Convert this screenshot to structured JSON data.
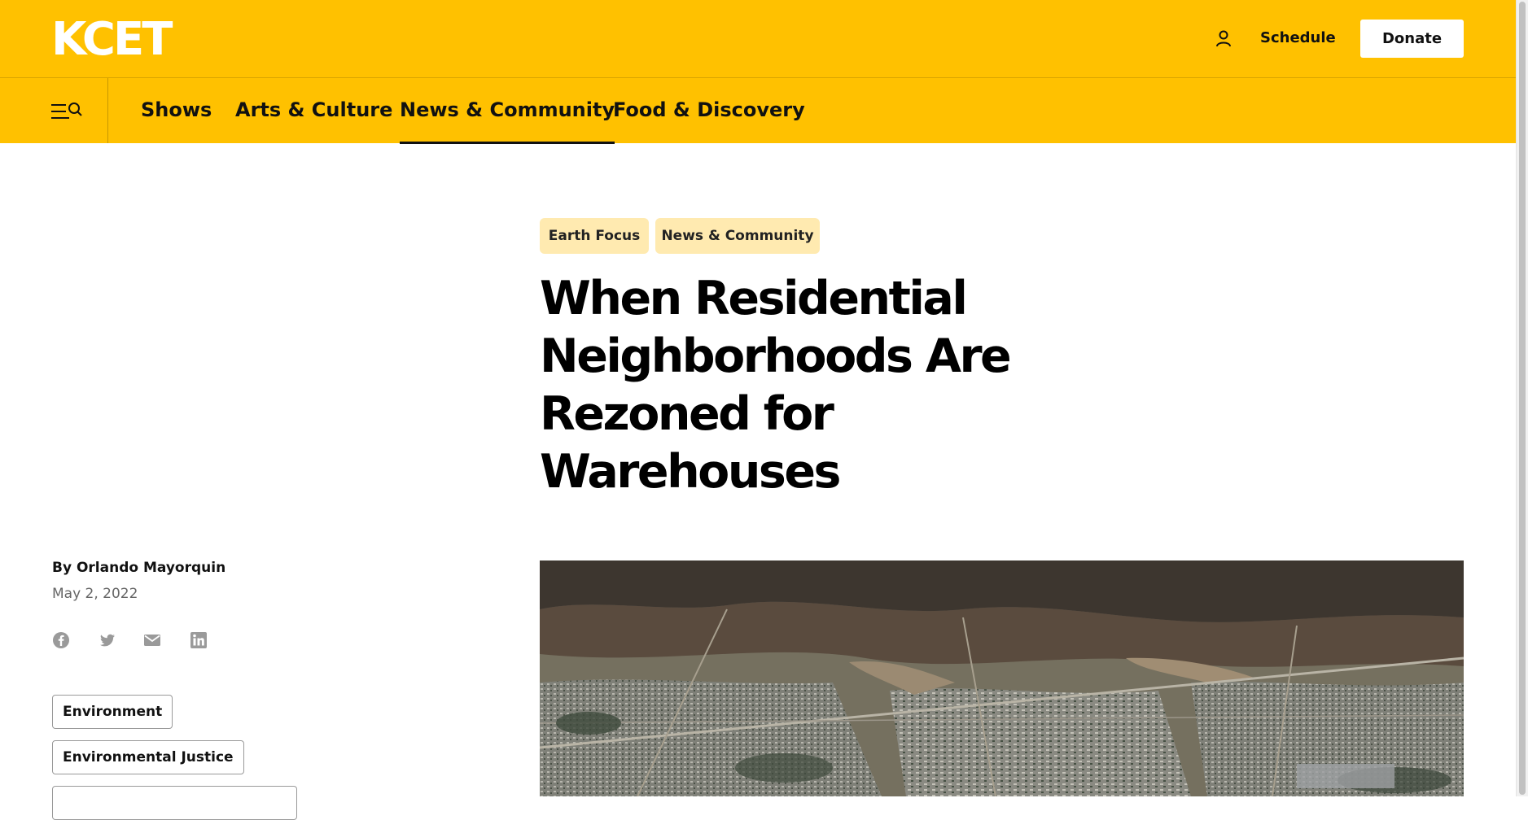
{
  "header": {
    "logo": "KCET",
    "schedule_label": "Schedule",
    "donate_label": "Donate"
  },
  "nav": {
    "items": [
      {
        "label": "Shows"
      },
      {
        "label": "Arts & Culture"
      },
      {
        "label": "News & Community",
        "active": true
      },
      {
        "label": "Food & Discovery"
      }
    ]
  },
  "article": {
    "categories": [
      "Earth Focus",
      "News & Community"
    ],
    "title_lines": [
      "When Residential",
      "Neighborhoods Are",
      "Rezoned for",
      "Warehouses"
    ],
    "byline": "By Orlando Mayorquin",
    "date": "May 2, 2022",
    "share_icons": [
      "facebook-icon",
      "twitter-icon",
      "email-icon",
      "linkedin-icon"
    ],
    "topics": [
      "Environment",
      "Environmental Justice",
      ""
    ]
  },
  "colors": {
    "brand_yellow": "#ffc100",
    "tag_bg": "#ffeab0",
    "text": "#111111"
  }
}
